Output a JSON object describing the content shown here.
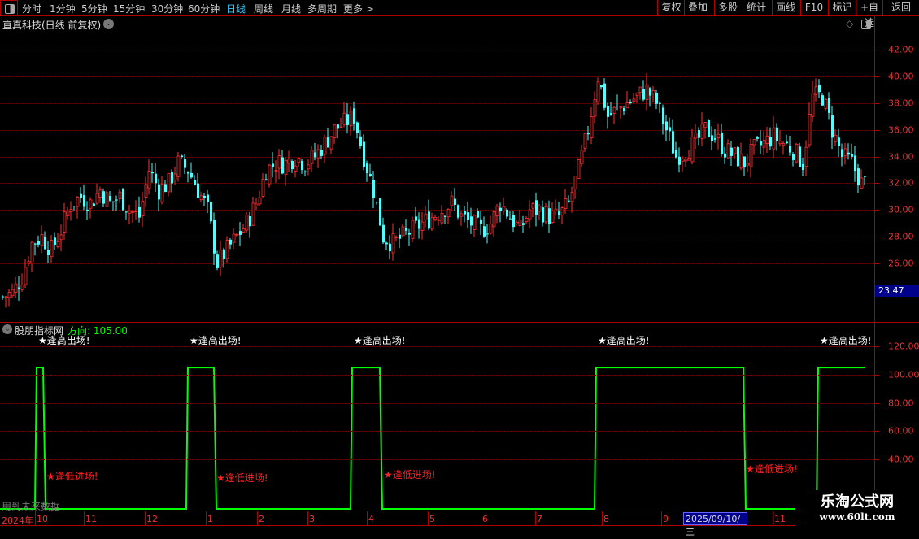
{
  "toolbar": {
    "periods": [
      "分时",
      "1分钟",
      "5分钟",
      "15分钟",
      "30分钟",
      "60分钟",
      "日线",
      "周线",
      "月线",
      "多周期",
      "更多 >"
    ],
    "active": "日线",
    "right_buttons": [
      "复权",
      "叠加",
      "多股",
      "统计",
      "画线",
      "F10",
      "标记",
      "+自选",
      "返回"
    ]
  },
  "price_pane": {
    "title": "直真科技(日线 前复权)",
    "axis_ticks": [
      "42.00",
      "40.00",
      "38.00",
      "36.00",
      "34.00",
      "32.00",
      "30.00",
      "28.00",
      "26.00"
    ],
    "current_price": "23.47",
    "current_price_bg": "#00008b",
    "up_color": "#ff3232",
    "down_color": "#54fcfc"
  },
  "indicator_pane": {
    "title": "股朋指标网",
    "value_label": "方向:",
    "value": "105.00",
    "axis_ticks": [
      "120.00",
      "100.00",
      "80.00",
      "60.00",
      "40.00"
    ],
    "line_color": "#00ff00",
    "high_signal": "★逢高出场!",
    "low_signal": "★逢低进场!",
    "low_value": 5,
    "high_value": 105,
    "note": "用到未来数据"
  },
  "chart_data": {
    "type": "candlestick",
    "ylim": [
      22,
      43.5
    ],
    "closes": [
      23.5,
      23.8,
      25,
      27.5,
      28,
      27,
      28.5,
      30.5,
      31,
      30.5,
      31.5,
      30.5,
      31,
      30,
      29.5,
      33,
      31.5,
      32,
      33.5,
      33,
      31.5,
      30,
      26,
      27,
      28,
      29,
      30.5,
      33,
      33.5,
      33.5,
      34,
      33.5,
      34,
      35,
      36,
      36.5,
      37,
      34,
      31.5,
      28,
      27.5,
      28,
      28.5,
      29,
      29.5,
      30,
      30.5,
      29.5,
      29,
      28.5,
      29,
      30.5,
      29.5,
      28.5,
      30,
      30,
      29.5,
      29.5,
      30.5,
      33,
      36,
      40,
      37,
      37.5,
      38,
      38.5,
      39,
      38,
      36,
      34,
      34.5,
      35,
      36,
      35.5,
      34.5,
      34,
      33.5,
      34.5,
      35,
      35.5,
      35,
      34.5,
      33.5,
      38.5,
      38.5,
      36,
      34,
      33.5,
      32
    ]
  },
  "x_axis": {
    "labels": [
      "2024年",
      "10",
      "11",
      "12",
      "1",
      "2",
      "3",
      "4",
      "5",
      "6",
      "7",
      "8",
      "9",
      "11"
    ],
    "cursor_date": "2025/09/10/三"
  },
  "watermark": {
    "name": "乐淘公式网",
    "url": "www.60lt.com"
  }
}
